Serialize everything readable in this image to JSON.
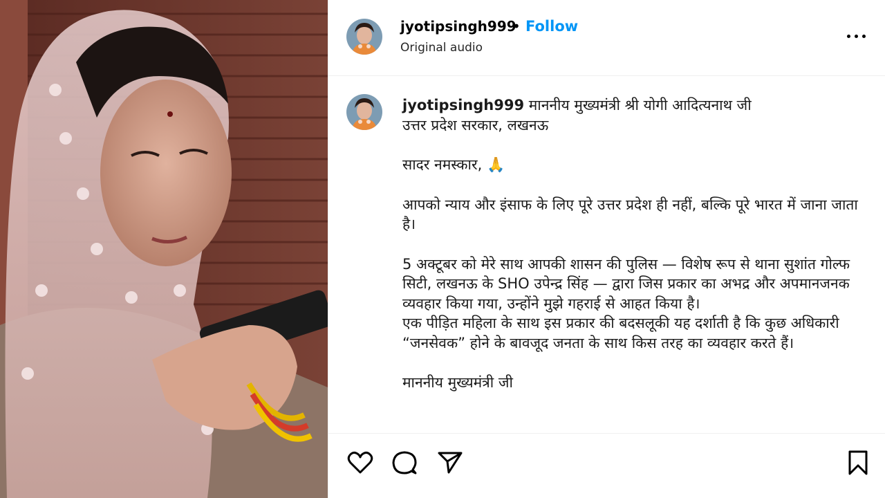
{
  "post": {
    "username": "jyotipsingh999",
    "separator": "•",
    "follow_label": "Follow",
    "audio": "Original audio"
  },
  "caption": {
    "username": "jyotipsingh999",
    "line1": "माननीय मुख्यमंत्री श्री योगी आदित्यनाथ जी",
    "line2": "उत्तर प्रदेश सरकार, लखनऊ",
    "greeting": "सादर नमस्कार, 🙏",
    "para1": "आपको न्याय और इंसाफ के लिए पूरे उत्तर प्रदेश ही नहीं, बल्कि पूरे भारत में जाना जाता है।",
    "para2a": "5 अक्टूबर को मेरे साथ आपकी शासन की पुलिस — विशेष रूप से थाना सुशांत गोल्फ सिटी, लखनऊ के SHO उपेन्द्र सिंह — द्वारा जिस प्रकार का अभद्र और अपमानजनक व्यवहार किया गया, उन्होंने मुझे गहराई से आहत किया है।",
    "para2b": "एक पीड़ित महिला के साथ इस प्रकार की बदसलूकी यह दर्शाती है कि कुछ अधिकारी “जनसेवक” होने के बावजूद जनता के साथ किस तरह का व्यवहार करते हैं।",
    "para3": "माननीय मुख्यमंत्री जी"
  },
  "icons": {
    "more": "more-options-icon",
    "like": "heart-icon",
    "comment": "comment-bubble-icon",
    "share": "paper-plane-icon",
    "save": "bookmark-icon"
  },
  "colors": {
    "follow": "#0095f6",
    "divider": "#efefef"
  }
}
